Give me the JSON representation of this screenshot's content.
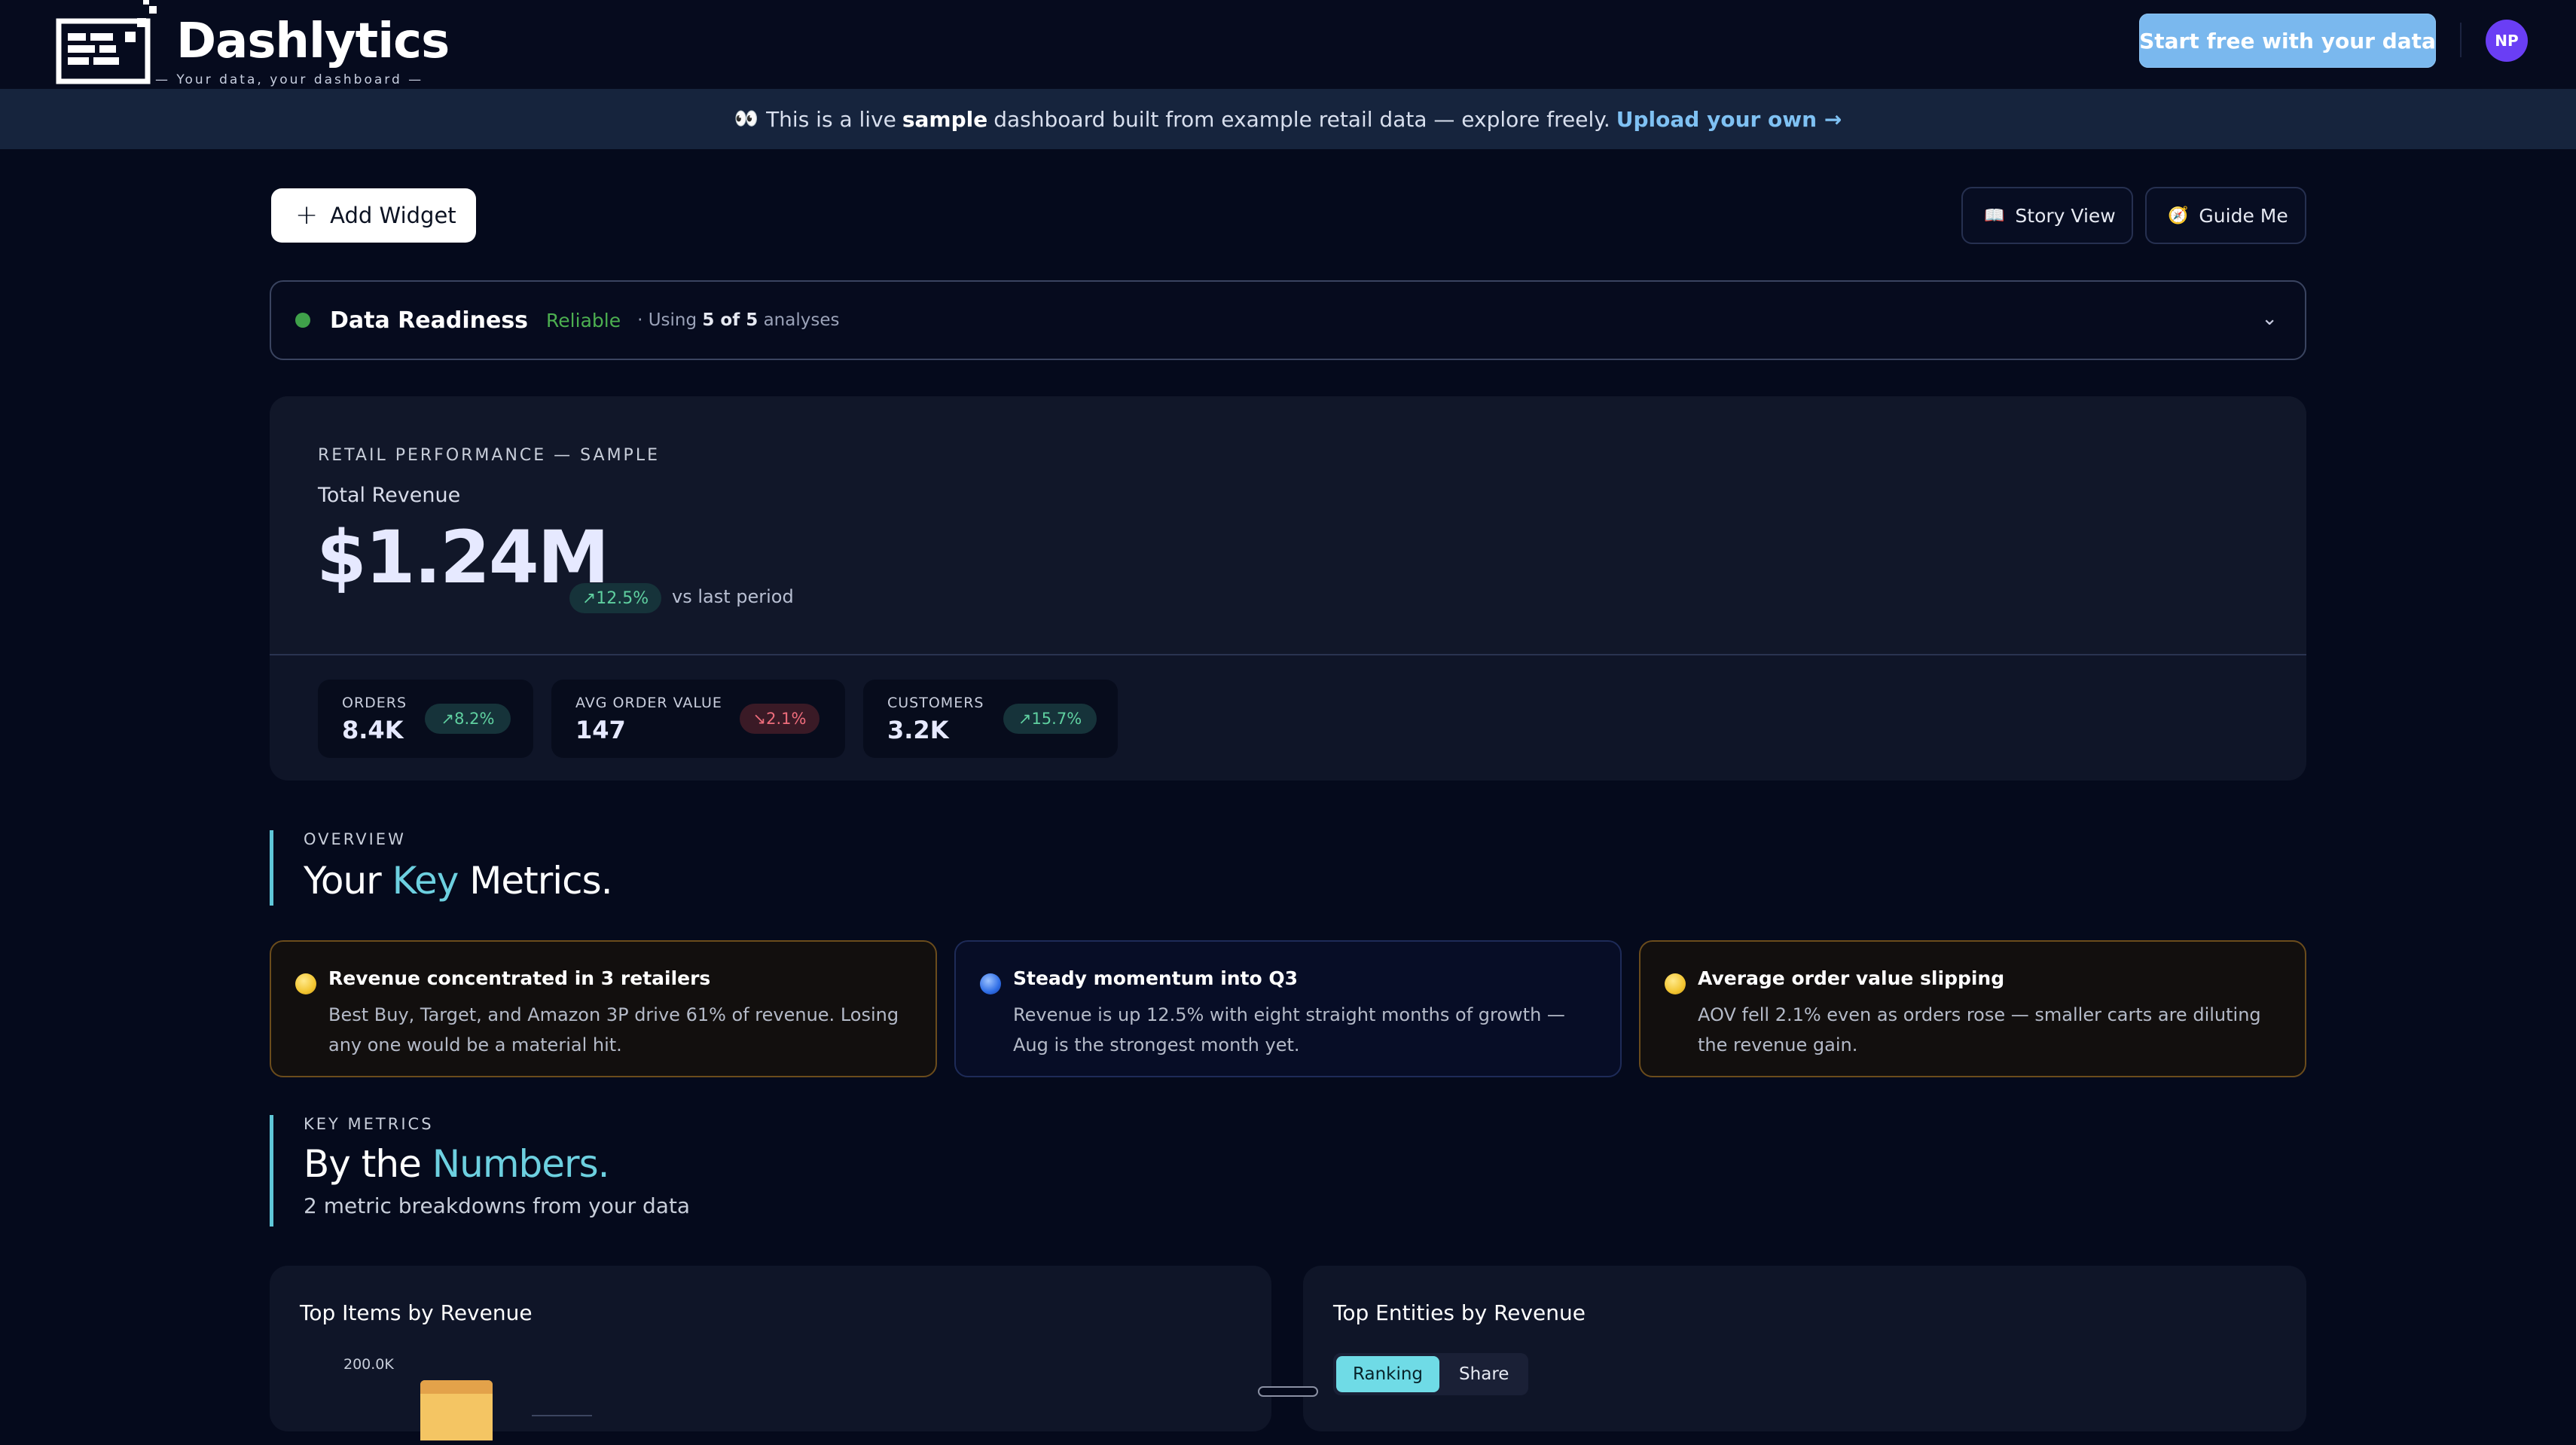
{
  "header": {
    "brand_name": "Dashlytics",
    "brand_tagline": "— Your data, your dashboard —",
    "cta_label": "Start free with your data",
    "avatar_initials": "NP"
  },
  "banner": {
    "icon": "eyes-emoji",
    "text_before": "This is a live",
    "text_bold": "sample",
    "text_after": "dashboard built from example retail data — explore freely.",
    "link_label": "Upload your own →"
  },
  "toolbar": {
    "add_widget_label": "Add Widget",
    "story_view_label": "Story View",
    "guide_me_label": "Guide Me"
  },
  "readiness": {
    "title": "Data Readiness",
    "status": "Reliable",
    "meta_prefix": "· Using",
    "meta_count": "5 of 5",
    "meta_suffix": "analyses"
  },
  "hero": {
    "eyebrow": "RETAIL PERFORMANCE — SAMPLE",
    "label": "Total Revenue",
    "value": "$1.24M",
    "trend": "12.5%",
    "trend_caption": "vs last period",
    "kpis": [
      {
        "label": "ORDERS",
        "value": "8.4K",
        "change": "8.2%",
        "direction": "up"
      },
      {
        "label": "AVG ORDER VALUE",
        "value": "147",
        "change": "2.1%",
        "direction": "down"
      },
      {
        "label": "CUSTOMERS",
        "value": "3.2K",
        "change": "15.7%",
        "direction": "up"
      }
    ]
  },
  "overview": {
    "eyebrow": "OVERVIEW",
    "title_pre": "Your",
    "title_hl": "Key",
    "title_post": "Metrics."
  },
  "insights": [
    {
      "title": "Revenue concentrated in 3 retailers",
      "body": "Best Buy, Target, and Amazon 3P drive 61% of revenue. Losing any one would be a material hit.",
      "tone": "amber"
    },
    {
      "title": "Steady momentum into Q3",
      "body": "Revenue is up 12.5% with eight straight months of growth — Aug is the strongest month yet.",
      "tone": "blue"
    },
    {
      "title": "Average order value slipping",
      "body": "AOV fell 2.1% even as orders rose — smaller carts are diluting the revenue gain.",
      "tone": "amber"
    }
  ],
  "key_metrics": {
    "eyebrow": "KEY METRICS",
    "title_pre": "By the",
    "title_hl": "Numbers.",
    "subtitle": "2 metric breakdowns from your data"
  },
  "charts": {
    "left_title": "Top Items by Revenue",
    "left_ytick": "200.0K",
    "right_title": "Top Entities by Revenue",
    "right_tabs": [
      "Ranking",
      "Share"
    ]
  },
  "colors": {
    "background": "#050a1c",
    "accent_cyan": "#6dd0e0",
    "cta_blue": "#7ab8ee",
    "positive": "#5fd0a0",
    "negative": "#ef6d7c",
    "reliable_green": "#4caf50"
  }
}
